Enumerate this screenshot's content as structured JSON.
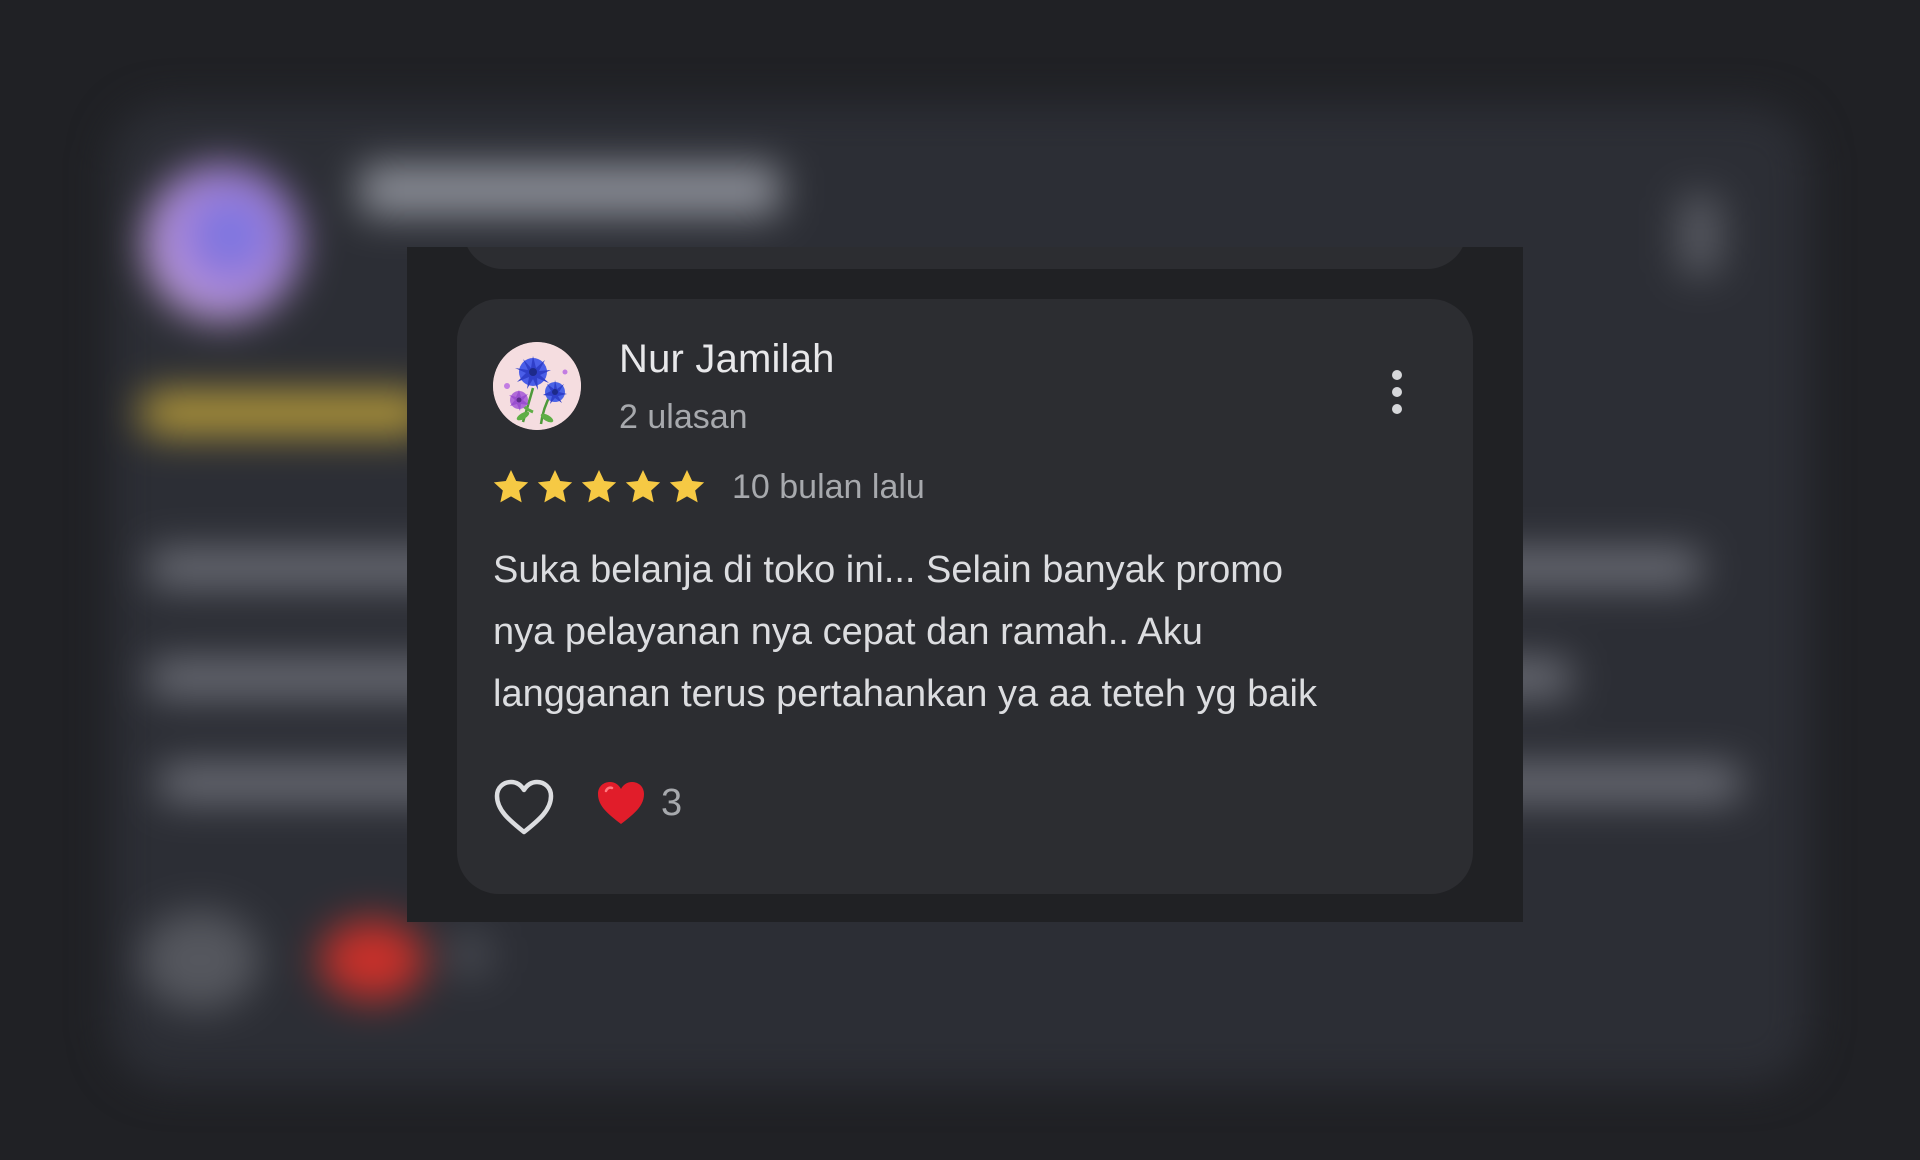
{
  "review": {
    "reviewer_name": "Nur Jamilah",
    "review_count": "2 ulasan",
    "rating": 5,
    "rating_max": 5,
    "date": "10 bulan lalu",
    "text_lines": [
      "Suka belanja di toko ini... Selain banyak promo",
      "nya pelayanan nya cepat dan ramah.. Aku",
      "langganan terus pertahankan ya aa teteh yg baik"
    ],
    "reaction_count": "3"
  },
  "icons": {
    "avatar": "flower-avatar",
    "menu": "more-vert-icon",
    "star": "star-icon",
    "like": "heart-outline-icon",
    "reaction": "heart-red-emoji"
  },
  "colors": {
    "background": "#202124",
    "card": "#2c2d31",
    "star": "#f6c944",
    "reaction_heart": "#e11d2a",
    "primary_text": "#e8e8ea",
    "secondary_text": "#a7a9ad"
  }
}
